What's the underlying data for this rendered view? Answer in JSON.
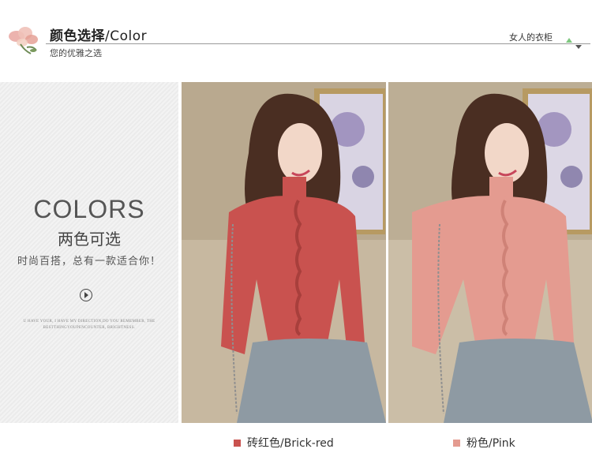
{
  "header": {
    "title_cn": "颜色选择",
    "title_en": "/Color",
    "subtitle": "您的优雅之选",
    "closet": "女人的衣柜"
  },
  "panel": {
    "colors_word": "COLORS",
    "two_colors": "两色可选",
    "tagline": "时尚百搭，总有一款适合你！",
    "tiny_line1": "U HAVE YOUR, I HAVE MY DIRECTION,DO YOU REMEMBER, THE",
    "tiny_line2": "BESTTHINGYOUPENCOUNTER, BRIGHTNESS."
  },
  "colors": {
    "brick_red": "#c9524f",
    "pink": "#e49b90"
  },
  "captions": {
    "brick": "砖红色/Brick-red",
    "pink": "粉色/Pink"
  }
}
